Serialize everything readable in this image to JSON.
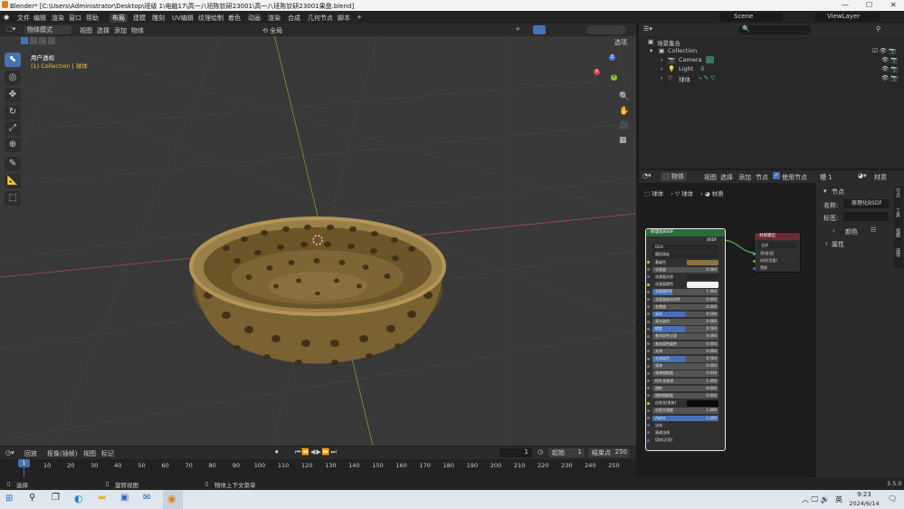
{
  "window": {
    "title": "Blender* [C:\\Users\\Administrator\\Desktop\\班级 1\\电脑17\\高一八班陈钦研23001\\高一八班陈钦研23001果盘.blend]",
    "min": "—",
    "max": "☐",
    "close": "✕"
  },
  "menu": {
    "items": [
      "文件",
      "编辑",
      "渲染",
      "窗口",
      "帮助"
    ],
    "workspaces": [
      "布局",
      "建模",
      "雕刻",
      "UV编辑",
      "纹理绘制",
      "着色",
      "动画",
      "渲染",
      "合成",
      "几何节点",
      "脚本"
    ],
    "active_workspace": "布局",
    "add_tab": "+",
    "scene": "Scene",
    "view_layer": "ViewLayer"
  },
  "viewport": {
    "mode": "物体模式",
    "menus": [
      "视图",
      "选择",
      "添加",
      "物体"
    ],
    "transform_orient": "全局",
    "options": "选项",
    "overlay_title": "用户透视",
    "overlay_collection": "(1) Collection | 球体",
    "gizmo": {
      "x": "X",
      "y": "Y",
      "z": "Z"
    }
  },
  "outliner": {
    "title": "场景集合",
    "items": [
      {
        "name": "Collection",
        "indent": 1
      },
      {
        "name": "Camera",
        "indent": 2
      },
      {
        "name": "Light",
        "indent": 2
      },
      {
        "name": "球体",
        "indent": 2
      }
    ]
  },
  "node_editor": {
    "object_label": "物体",
    "menus": [
      "视图",
      "选择",
      "添加",
      "节点"
    ],
    "use_nodes": "使用节点",
    "slot": "槽 1",
    "material_label": "材质",
    "breadcrumb": [
      "球体",
      "球体",
      "材质"
    ],
    "bsdf_title": "原理化BSDF",
    "bsdf_out": "BSDF",
    "dist": "GGX",
    "sss": "随机游走",
    "rows": [
      {
        "label": "基础色",
        "value": "",
        "kind": "color",
        "sock": "y"
      },
      {
        "label": "次表面",
        "value": "0.000",
        "kind": "plain",
        "sock": "g"
      },
      {
        "label": "次表面半径",
        "value": "",
        "kind": "dropdown",
        "sock": "p"
      },
      {
        "label": "次表面颜色",
        "value": "",
        "kind": "white",
        "sock": "y"
      },
      {
        "label": "次表面IOR",
        "value": "1.400",
        "kind": "blue",
        "fill": 0.3,
        "sock": "g"
      },
      {
        "label": "次表面各向异性",
        "value": "0.000",
        "kind": "plain",
        "sock": "g"
      },
      {
        "label": "金属度",
        "value": "0.000",
        "kind": "plain",
        "sock": "g"
      },
      {
        "label": "高光",
        "value": "0.500",
        "kind": "blue",
        "fill": 0.5,
        "sock": "g"
      },
      {
        "label": "高光染色",
        "value": "0.000",
        "kind": "plain",
        "sock": "g"
      },
      {
        "label": "糙度",
        "value": "0.500",
        "kind": "blue",
        "fill": 0.5,
        "sock": "g"
      },
      {
        "label": "各向异性过滤",
        "value": "0.000",
        "kind": "plain",
        "sock": "g"
      },
      {
        "label": "各向异性旋转",
        "value": "0.000",
        "kind": "plain",
        "sock": "g"
      },
      {
        "label": "光泽",
        "value": "0.000",
        "kind": "plain",
        "sock": "g"
      },
      {
        "label": "光泽染色",
        "value": "0.500",
        "kind": "blue",
        "fill": 0.5,
        "sock": "g"
      },
      {
        "label": "清漆",
        "value": "0.000",
        "kind": "plain",
        "sock": "g"
      },
      {
        "label": "清漆粗糙度",
        "value": "0.030",
        "kind": "plain",
        "sock": "g"
      },
      {
        "label": "IOR 折射率",
        "value": "1.450",
        "kind": "plain",
        "sock": "g"
      },
      {
        "label": "透射",
        "value": "0.000",
        "kind": "plain",
        "sock": "g"
      },
      {
        "label": "透射粗糙度",
        "value": "0.000",
        "kind": "plain",
        "sock": "g"
      },
      {
        "label": "自发光(发射)",
        "value": "",
        "kind": "black",
        "sock": "y"
      },
      {
        "label": "自发光强度",
        "value": "1.000",
        "kind": "plain",
        "sock": "g"
      },
      {
        "label": "Alpha",
        "value": "1.000",
        "kind": "blue",
        "fill": 1.0,
        "sock": "g"
      },
      {
        "label": "法向",
        "value": "",
        "kind": "text",
        "sock": "p"
      },
      {
        "label": "清漆法线",
        "value": "",
        "kind": "text",
        "sock": "p"
      },
      {
        "label": "切向(正切)",
        "value": "",
        "kind": "text",
        "sock": "p"
      }
    ],
    "output_title": "材质输出",
    "output_target": "全部",
    "output_rows": [
      "表(曲)面",
      "体积(音量)",
      "置换"
    ]
  },
  "sidebar": {
    "section": "节点",
    "name_label": "名称:",
    "name_value": "原理化BSDF",
    "label_label": "标签:",
    "color": "颜色",
    "properties": "属性",
    "tabs": [
      "节点",
      "工具",
      "视图",
      "选项"
    ]
  },
  "timeline": {
    "menus": [
      "回放",
      "抠像(插帧)",
      "视图",
      "标记"
    ],
    "current_frame": "1",
    "start_label": "起始",
    "start": "1",
    "end_label": "结束点",
    "end": "250",
    "ticks": [
      "0",
      "10",
      "20",
      "30",
      "40",
      "50",
      "60",
      "70",
      "80",
      "90",
      "100",
      "110",
      "120",
      "130",
      "140",
      "150",
      "160",
      "170",
      "180",
      "190",
      "200",
      "210",
      "220",
      "230",
      "240",
      "250"
    ],
    "current": "1"
  },
  "statusbar": {
    "select": "选择",
    "rotate": "旋转视图",
    "context": "物体上下文菜单",
    "version": "3.5.0"
  },
  "taskbar": {
    "time": "9:23",
    "date": "2024/6/14",
    "lang": "英"
  },
  "colors": {
    "accent": "#4772b3",
    "basket": "#8c7442",
    "bg_viewport": "#393939"
  }
}
